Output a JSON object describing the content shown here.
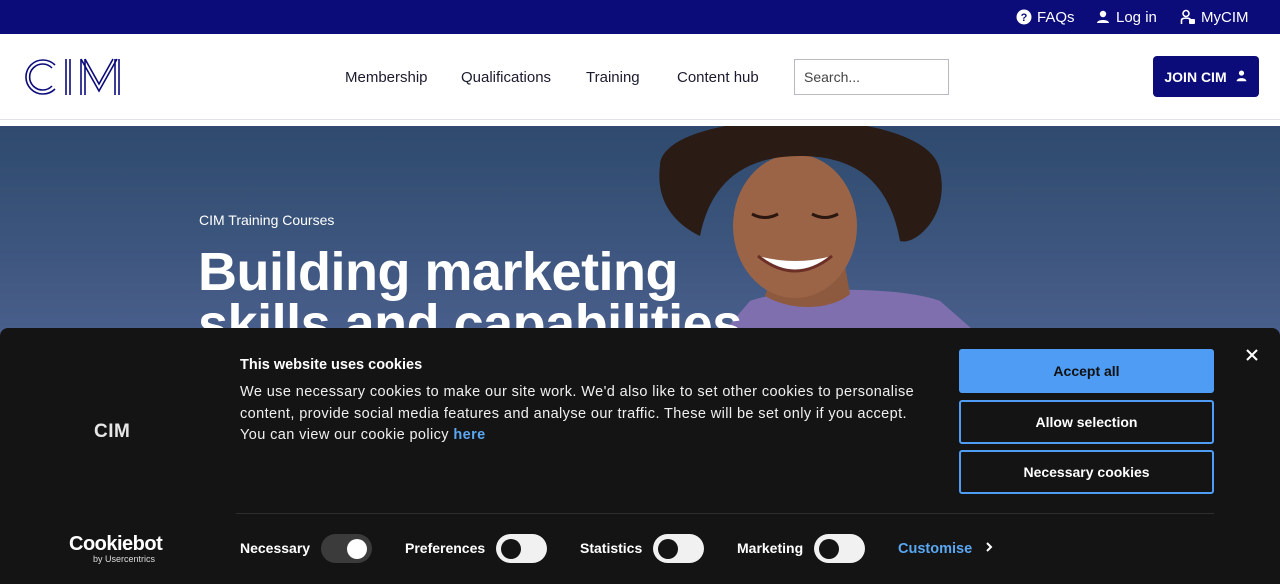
{
  "topbar": {
    "faqs": "FAQs",
    "login": "Log in",
    "mycim": "MyCIM"
  },
  "header": {
    "logo_text": "CIM",
    "nav": [
      "Membership",
      "Qualifications",
      "Training",
      "Content hub"
    ],
    "search_placeholder": "Search...",
    "join_label": "JOIN CIM"
  },
  "hero": {
    "subtitle": "CIM Training Courses",
    "title": "Building marketing skills and capabilities"
  },
  "cookie_banner": {
    "logo_text": "CIM",
    "title": "This website uses cookies",
    "text": "We use necessary cookies to make our site work. We'd also like to set other cookies to personalise content, provide social media features and analyse our traffic. These will be set only if you accept. You can view our cookie policy",
    "link_text": "here",
    "buttons": {
      "accept": "Accept all",
      "allow": "Allow selection",
      "necessary": "Necessary cookies"
    },
    "cookiebot": {
      "brand": "Cookiebot",
      "sub": "by Usercentrics"
    },
    "toggles": [
      {
        "label": "Necessary",
        "on": true
      },
      {
        "label": "Preferences",
        "on": false
      },
      {
        "label": "Statistics",
        "on": false
      },
      {
        "label": "Marketing",
        "on": false
      }
    ],
    "customise": "Customise"
  },
  "colors": {
    "brand_navy": "#0b0b7a",
    "cookie_accent": "#4e9cf3",
    "cookie_bg": "#141414"
  }
}
